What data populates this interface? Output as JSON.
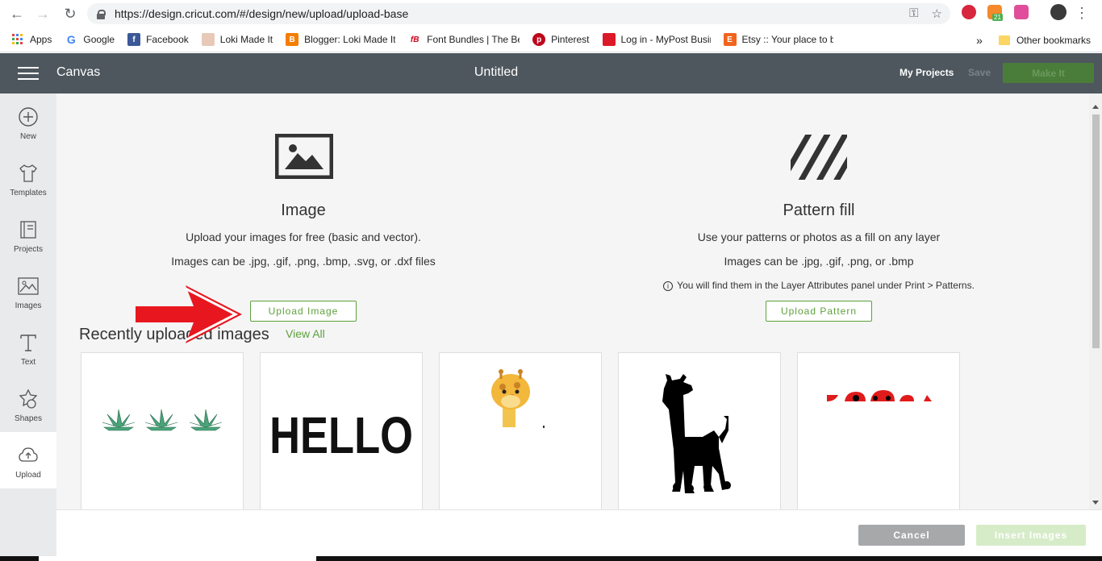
{
  "browser": {
    "url": "https://design.cricut.com/#/design/new/upload/upload-base",
    "badge_count": "21",
    "bookmarks": [
      {
        "label": "Apps",
        "icon": "apps-grid-icon",
        "color": "#4285f4"
      },
      {
        "label": "Google",
        "icon": "google-icon",
        "color": "#4285f4"
      },
      {
        "label": "Facebook",
        "icon": "facebook-icon",
        "color": "#3b5998"
      },
      {
        "label": "Loki Made It",
        "icon": "loki-made-it-icon",
        "color": "#c98b6b"
      },
      {
        "label": "Blogger: Loki Made It",
        "icon": "blogger-icon",
        "color": "#f57d00"
      },
      {
        "label": "Font Bundles | The Be",
        "icon": "font-bundles-icon",
        "color": "#d0021b"
      },
      {
        "label": "Pinterest",
        "icon": "pinterest-icon",
        "color": "#bd081c"
      },
      {
        "label": "Log in - MyPost Busin",
        "icon": "mypost-icon",
        "color": "#dc1928"
      },
      {
        "label": "Etsy :: Your place to b",
        "icon": "etsy-icon",
        "color": "#f1641e"
      }
    ],
    "overflow": "»",
    "other_bookmarks": "Other bookmarks"
  },
  "header": {
    "app_title": "Canvas",
    "doc_title": "Untitled",
    "my_projects": "My Projects",
    "save": "Save",
    "make_it": "Make It"
  },
  "sidebar": {
    "items": [
      {
        "label": "New",
        "icon": "plus-circle-icon"
      },
      {
        "label": "Templates",
        "icon": "tshirt-icon"
      },
      {
        "label": "Projects",
        "icon": "book-icon"
      },
      {
        "label": "Images",
        "icon": "image-icon"
      },
      {
        "label": "Text",
        "icon": "text-icon"
      },
      {
        "label": "Shapes",
        "icon": "shapes-icon"
      },
      {
        "label": "Upload",
        "icon": "upload-cloud-icon"
      }
    ]
  },
  "upload": {
    "image": {
      "title": "Image",
      "desc1": "Upload your images for free (basic and vector).",
      "desc2": "Images can be .jpg, .gif, .png, .bmp, .svg, or .dxf files",
      "button": "Upload Image"
    },
    "pattern": {
      "title": "Pattern fill",
      "desc1": "Use your patterns or photos as a fill on any layer",
      "desc2": "Images can be .jpg, .gif, .png, or .bmp",
      "note": "You will find them in the Layer Attributes panel under Print > Patterns.",
      "button": "Upload Pattern"
    }
  },
  "recent": {
    "title": "Recently uploaded images",
    "view_all": "View All",
    "hello_text": "HELLO"
  },
  "footer": {
    "cancel": "Cancel",
    "insert": "Insert Images"
  },
  "colors": {
    "header_bg": "#4e575e",
    "accent_green": "#5ea13b",
    "annotation_arrow": "#e8171f"
  }
}
